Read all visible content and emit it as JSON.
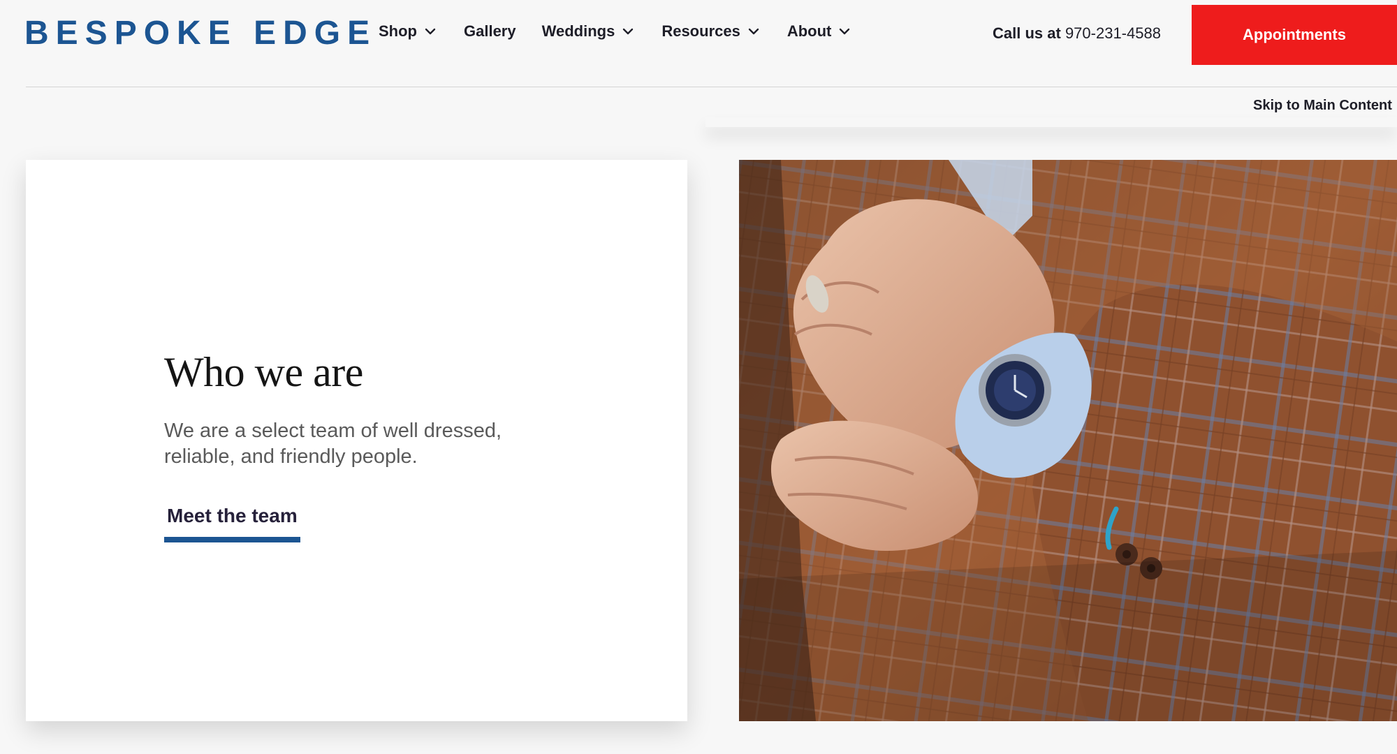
{
  "header": {
    "logo": "BESPOKE EDGE",
    "nav": [
      {
        "label": "Shop",
        "has_dropdown": true
      },
      {
        "label": "Gallery",
        "has_dropdown": false
      },
      {
        "label": "Weddings",
        "has_dropdown": true
      },
      {
        "label": "Resources",
        "has_dropdown": true
      },
      {
        "label": "About",
        "has_dropdown": true
      }
    ],
    "call_label": "Call us at",
    "phone": "970-231-4588",
    "appointments_label": "Appointments",
    "skip_link": "Skip to Main Content"
  },
  "about": {
    "title": "Who we are",
    "description": "We are a select team of well dressed, reliable, and friendly people.",
    "cta": "Meet the team"
  },
  "colors": {
    "brand_blue": "#1c5592",
    "accent_red": "#ee1c1c",
    "page_bg": "#f7f7f7",
    "text_dark": "#1e1e28"
  },
  "icons": {
    "dropdown": "chevron-down-icon"
  }
}
